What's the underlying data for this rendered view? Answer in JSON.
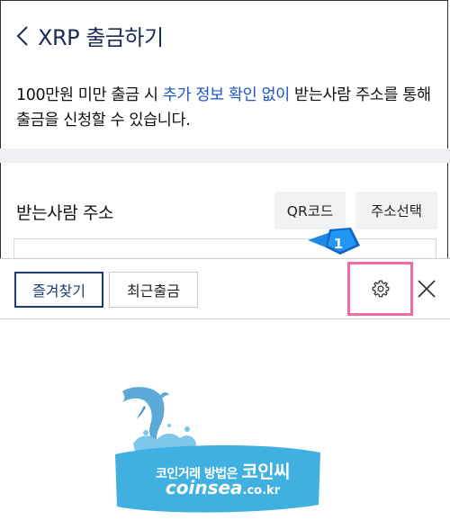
{
  "header": {
    "title": "XRP 출금하기"
  },
  "notice": {
    "prefix": "100만원 미만 출금 시 ",
    "highlight": "추가 정보 확인 없이",
    "suffix": " 받는사람 주소를 통해",
    "line2": "출금을 신청할 수 있습니다."
  },
  "receiver": {
    "label": "받는사람 주소",
    "qr_button": "QR코드",
    "address_select_button": "주소선택"
  },
  "panel": {
    "tabs": [
      {
        "label": "즐겨찾기",
        "selected": true
      },
      {
        "label": "최근출금",
        "selected": false
      }
    ]
  },
  "annotation": {
    "step_number": "1"
  },
  "watermark": {
    "line1_prefix": "코인거래 방법은 ",
    "line1_brand": "코인씨",
    "line2_main": "coinsea",
    "line2_suffix": ".co.kr"
  },
  "colors": {
    "title": "#1b2c55",
    "highlight": "#1f57c6",
    "tab_selected": "#1c3b73",
    "annotation_box": "#f06aa8",
    "badge": "#1e88e5"
  }
}
